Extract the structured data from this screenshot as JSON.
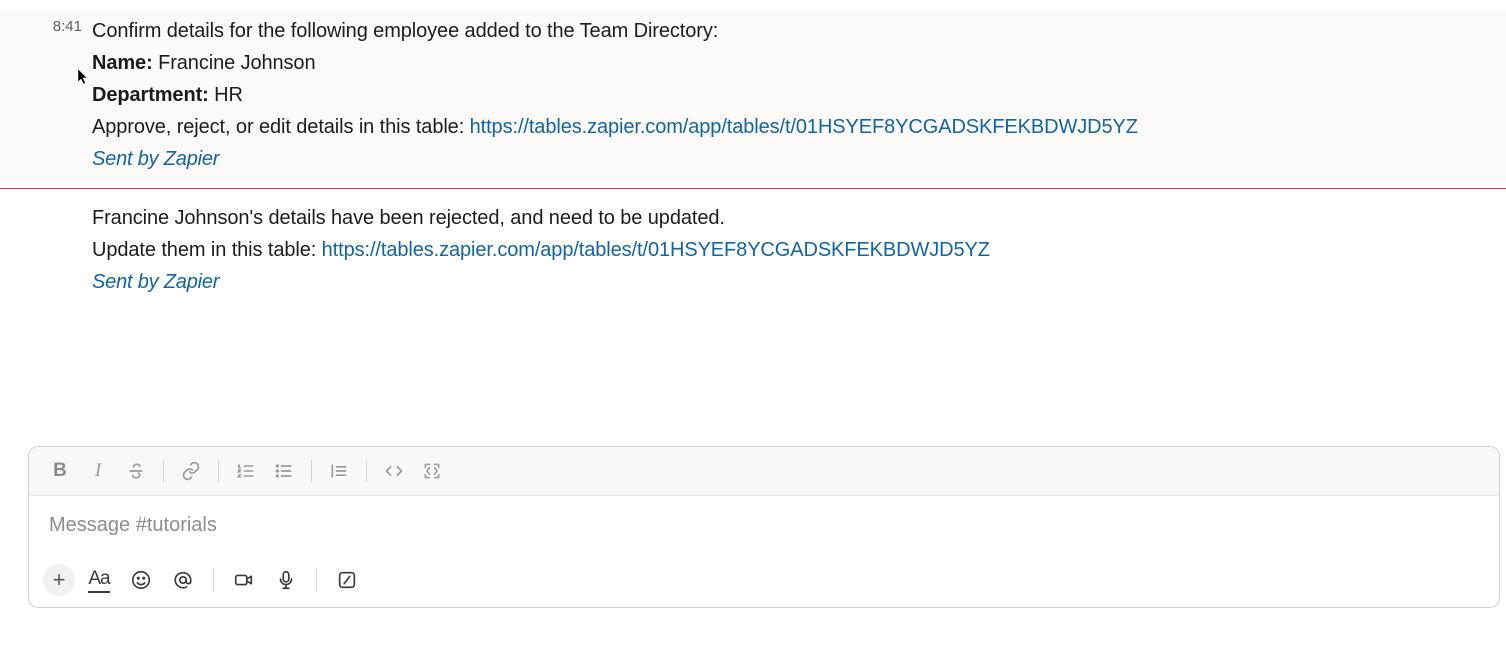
{
  "messages": {
    "first": {
      "timestamp": "8:41",
      "intro": "Confirm details for the following employee added to the Team Directory:",
      "name_label": "Name:",
      "name_value": " Francine Johnson",
      "dept_label": "Department:",
      "dept_value": " HR",
      "action_prefix": "Approve, reject, or edit details in this table: ",
      "link": "https://tables.zapier.com/app/tables/t/01HSYEF8YCGADSKFEKBDWJD5YZ",
      "sent_by": "Sent by Zapier"
    },
    "second": {
      "line1": "Francine Johnson's details have been rejected, and need to be updated.",
      "line2_prefix": "Update them in this table: ",
      "link": "https://tables.zapier.com/app/tables/t/01HSYEF8YCGADSKFEKBDWJD5YZ",
      "sent_by": "Sent by Zapier"
    }
  },
  "composer": {
    "placeholder": "Message #tutorials"
  }
}
